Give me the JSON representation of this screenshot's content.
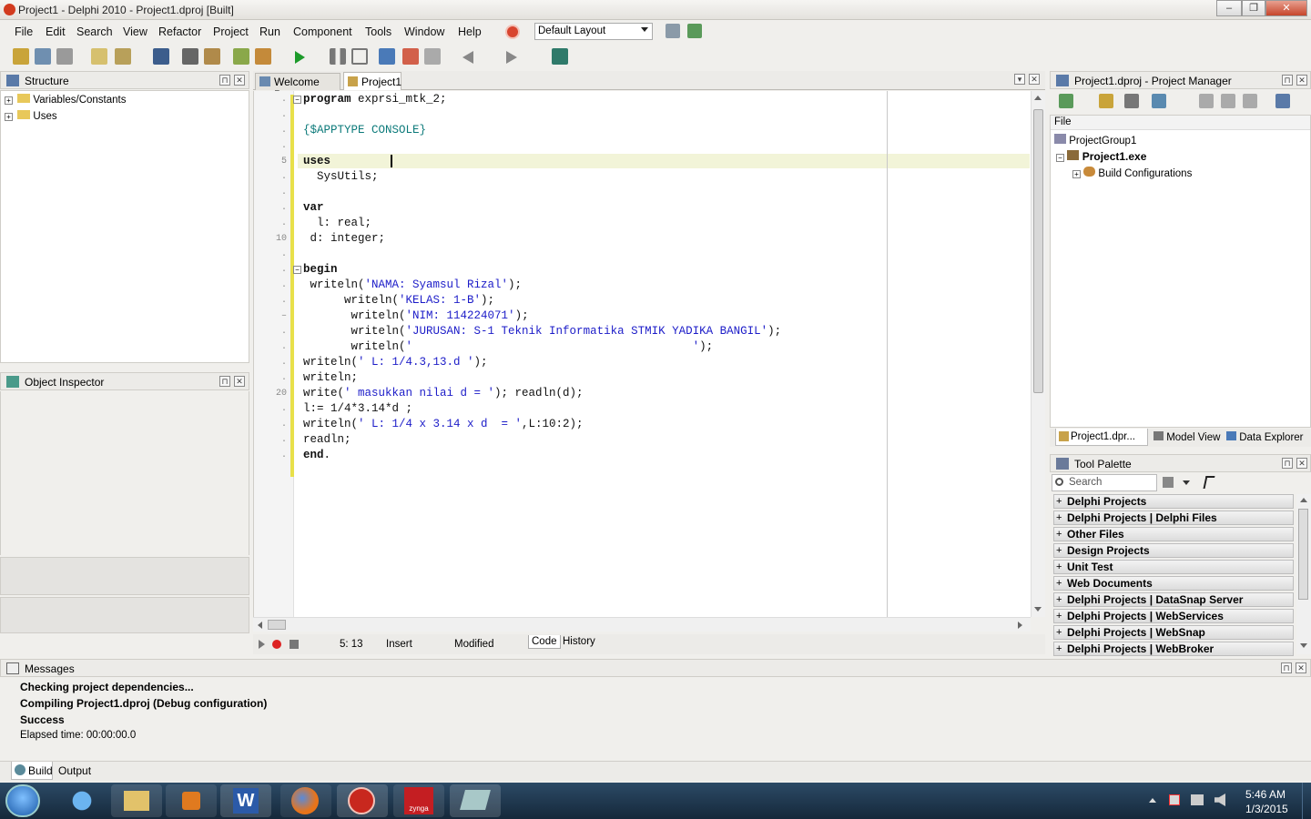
{
  "window": {
    "title": "Project1 - Delphi 2010 - Project1.dproj [Built]",
    "minimize": "–",
    "maximize": "❐",
    "close": "✕"
  },
  "menu": [
    "File",
    "Edit",
    "Search",
    "View",
    "Refactor",
    "Project",
    "Run",
    "Component",
    "Tools",
    "Window",
    "Help"
  ],
  "layout_select": "Default Layout",
  "structure": {
    "title": "Structure",
    "items": [
      "Variables/Constants",
      "Uses"
    ]
  },
  "inspector": {
    "title": "Object Inspector"
  },
  "editor": {
    "tabs": [
      "Welcome Page",
      "Project1"
    ],
    "gutter": [
      ".",
      ".",
      ".",
      ".",
      "5",
      ".",
      ".",
      ".",
      ".",
      "10",
      ".",
      ".",
      ".",
      ".",
      "–",
      ".",
      ".",
      ".",
      ".",
      "20",
      ".",
      ".",
      ".",
      ".",
      "."
    ],
    "lines": [
      {
        "t": "program exprsi_mtk_2;"
      },
      {
        "t": ""
      },
      {
        "t": "{$APPTYPE CONSOLE}"
      },
      {
        "t": ""
      },
      {
        "t": "uses"
      },
      {
        "t": "  SysUtils;"
      },
      {
        "t": ""
      },
      {
        "t": "var"
      },
      {
        "t": "  l: real;"
      },
      {
        "t": " d: integer;"
      },
      {
        "t": ""
      },
      {
        "t": "begin"
      },
      {
        "t": " writeln('NAMA: Syamsul Rizal');"
      },
      {
        "t": "      writeln('KELAS: 1-B');"
      },
      {
        "t": "       writeln('NIM: 114224071');"
      },
      {
        "t": "       writeln('JURUSAN: S-1 Teknik Informatika STMIK YADIKA BANGIL');"
      },
      {
        "t": "       writeln('                                         ');"
      },
      {
        "t": "writeln(' L: 1/4.3,13.d ');"
      },
      {
        "t": "writeln;"
      },
      {
        "t": "write(' masukkan nilai d = '); readln(d);"
      },
      {
        "t": "l:= 1/4*3.14*d ;"
      },
      {
        "t": "writeln(' L: 1/4 x 3.14 x d  = ',L:10:2);"
      },
      {
        "t": "readln;"
      },
      {
        "t": "end."
      }
    ],
    "status": {
      "pos": "5: 13",
      "mode": "Insert",
      "state": "Modified",
      "tab_code": "Code",
      "tab_history": "History"
    }
  },
  "project_manager": {
    "title": "Project1.dproj - Project Manager",
    "column": "File",
    "items": [
      "ProjectGroup1",
      "Project1.exe",
      "Build Configurations"
    ],
    "tabs": [
      "Project1.dpr...",
      "Model View",
      "Data Explorer"
    ]
  },
  "tool_palette": {
    "title": "Tool Palette",
    "search_placeholder": "Search",
    "categories": [
      "Delphi Projects",
      "Delphi Projects | Delphi Files",
      "Other Files",
      "Design Projects",
      "Unit Test",
      "Web Documents",
      "Delphi Projects | DataSnap Server",
      "Delphi Projects | WebServices",
      "Delphi Projects | WebSnap",
      "Delphi Projects | WebBroker"
    ]
  },
  "messages": {
    "title": "Messages",
    "lines": [
      "Checking project dependencies...",
      "Compiling Project1.dproj (Debug configuration)",
      "Success",
      "Elapsed time: 00:00:00.0"
    ],
    "tabs": [
      "Build",
      "Output"
    ]
  },
  "taskbar": {
    "time": "5:46 AM",
    "date": "1/3/2015",
    "apps": [
      "start-orb",
      "internet-explorer",
      "file-explorer",
      "media-player",
      "word",
      "firefox",
      "delphi",
      "zynga",
      "notes"
    ],
    "zynga_label": "zynga",
    "word_letter": "W"
  }
}
